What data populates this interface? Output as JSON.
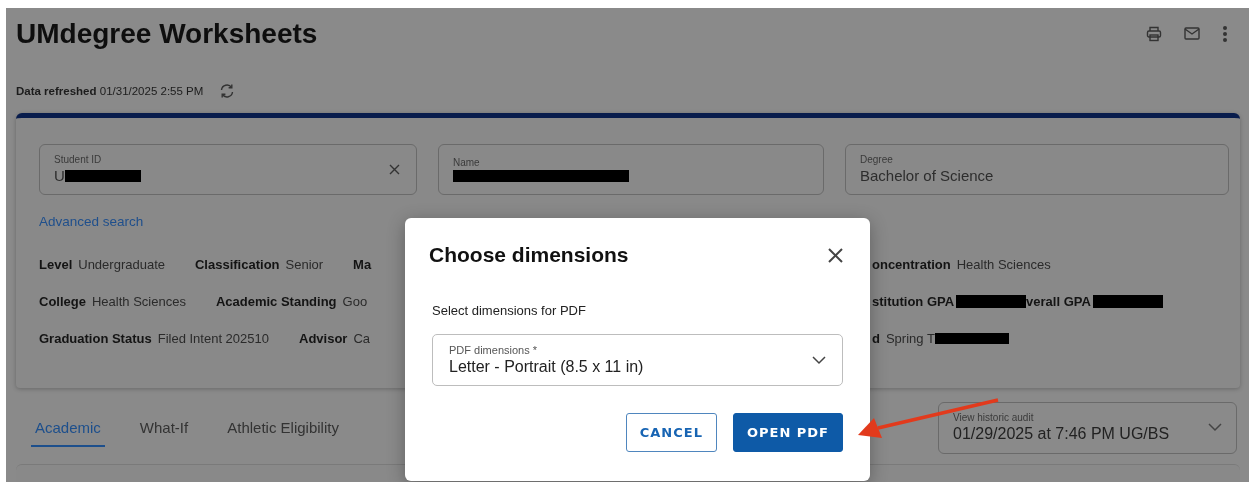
{
  "header": {
    "title": "UMdegree Worksheets",
    "actions": [
      {
        "kind": "print"
      },
      {
        "kind": "mail"
      },
      {
        "kind": "more"
      }
    ]
  },
  "refresh": {
    "label": "Data refreshed",
    "value": "01/31/2025 2:55 PM"
  },
  "search_fields": [
    {
      "label": "Student ID",
      "value": "U",
      "redacted": true,
      "clearable": true
    },
    {
      "label": "Name",
      "redacted": true,
      "clearable": false
    },
    {
      "label": "Degree",
      "value": "Bachelor of Science",
      "redacted": false,
      "clearable": false
    }
  ],
  "advanced_search": "Advanced search",
  "info_rows": [
    {
      "left": [
        {
          "label": "Level",
          "value": "Undergraduate"
        },
        {
          "label": "Classification",
          "value": "Senior"
        },
        {
          "label": "Ma"
        }
      ],
      "right": [
        {
          "label": "oncentration",
          "value": "Health Sciences"
        }
      ]
    },
    {
      "left": [
        {
          "label": "College",
          "value": "Health Sciences"
        },
        {
          "label": "Academic Standing",
          "value": "Goo"
        }
      ],
      "right": [
        {
          "label": "stitution GPA",
          "redacted": true
        },
        {
          "label": "verall GPA",
          "redacted": true
        }
      ]
    },
    {
      "left": [
        {
          "label": "Graduation Status",
          "value": "Filed Intent 202510"
        },
        {
          "label": "Advisor",
          "value": "Ca"
        }
      ],
      "right": [
        {
          "label": "d",
          "value": "Spring T",
          "redacted": true
        }
      ]
    }
  ],
  "tabs": [
    {
      "label": "Academic",
      "selected": true
    },
    {
      "label": "What-If",
      "selected": false
    },
    {
      "label": "Athletic Eligibility",
      "selected": false
    }
  ],
  "historic_audit": {
    "label": "View historic audit",
    "value": "01/29/2025 at 7:46 PM UG/BS"
  },
  "dialog": {
    "title": "Choose dimensions",
    "prompt": "Select dimensions for PDF",
    "select": {
      "label": "PDF dimensions *",
      "value": "Letter - Portrait (8.5 x 11 in)"
    },
    "buttons": [
      {
        "label": "CANCEL",
        "kind": "secondary"
      },
      {
        "label": "OPEN PDF",
        "kind": "primary"
      }
    ]
  },
  "annotation": {
    "kind": "arrow"
  }
}
